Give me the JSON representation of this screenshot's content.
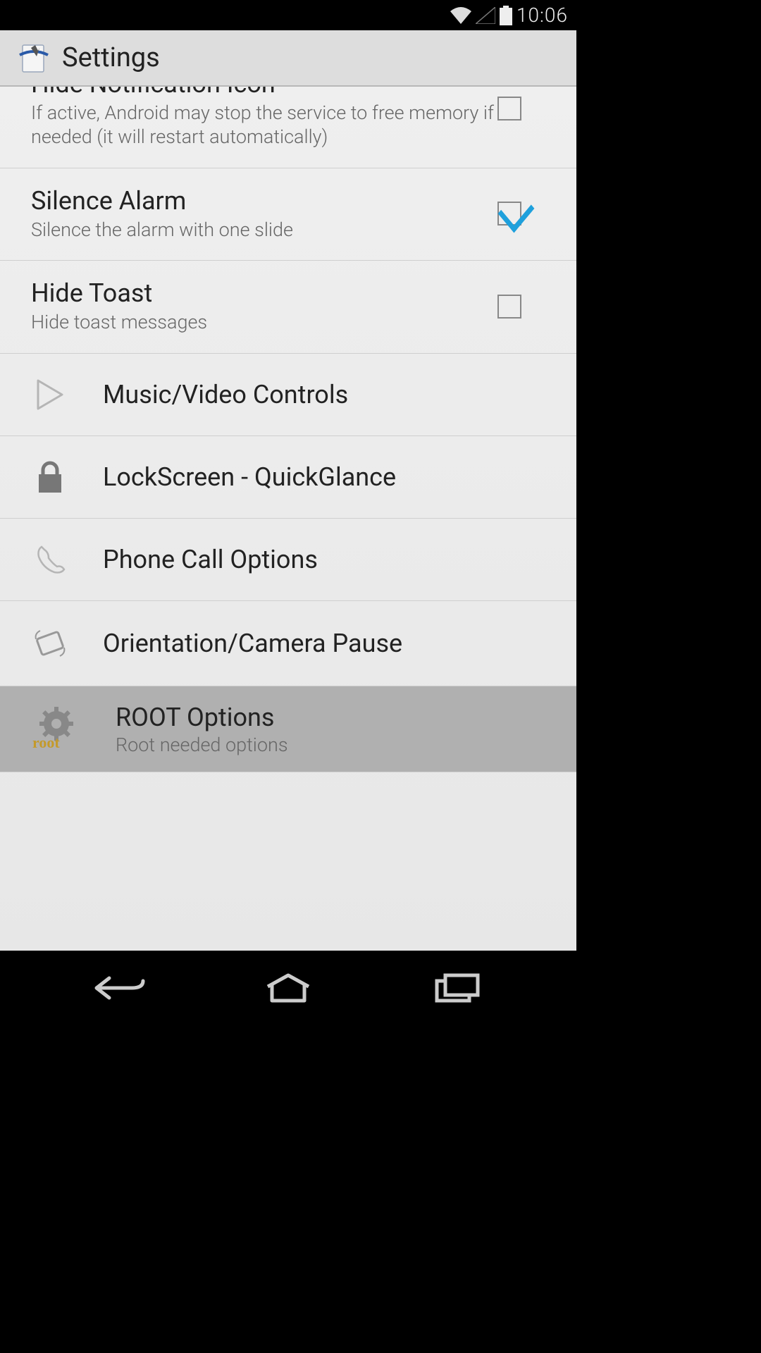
{
  "statusbar": {
    "time": "10:06"
  },
  "actionbar": {
    "title": "Settings"
  },
  "prefs": {
    "hide_notification": {
      "title": "Hide Notification Icon",
      "summary": "If active, Android may stop the service to free memory if needed (it will restart automatically)",
      "checked": false
    },
    "silence_alarm": {
      "title": "Silence Alarm",
      "summary": "Silence the alarm with one slide",
      "checked": true
    },
    "hide_toast": {
      "title": "Hide Toast",
      "summary": "Hide toast messages",
      "checked": false
    }
  },
  "headers": {
    "music": {
      "title": "Music/Video Controls"
    },
    "lockscreen": {
      "title": "LockScreen - QuickGlance"
    },
    "phone": {
      "title": "Phone Call Options"
    },
    "orientation": {
      "title": "Orientation/Camera Pause"
    },
    "root": {
      "title": "ROOT Options",
      "summary": "Root needed options"
    }
  }
}
